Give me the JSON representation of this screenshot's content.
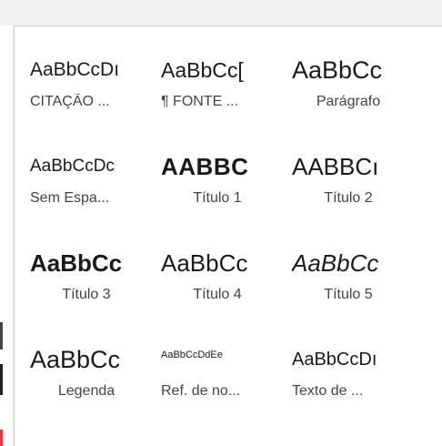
{
  "gallery": {
    "tiles": [
      {
        "preview": "AaBbCcDı",
        "label": "CITAÇÃO ..."
      },
      {
        "preview": "AaBbCc[",
        "label": "¶ FONTE ..."
      },
      {
        "preview": "AaBbCc",
        "label": "Parágrafo"
      },
      {
        "preview": "AaBbCcDc",
        "label": "Sem Espa..."
      },
      {
        "preview": "AABBC",
        "label": "Título 1"
      },
      {
        "preview": "AABBCı",
        "label": "Título 2"
      },
      {
        "preview": "AaBbCc",
        "label": "Título 3"
      },
      {
        "preview": "AaBbCc",
        "label": "Título 4"
      },
      {
        "preview": "AaBbCc",
        "label": "Título 5"
      },
      {
        "preview": "AaBbCc",
        "label": "Legenda"
      },
      {
        "preview": "AaBbCcDdEe",
        "label": "Ref. de no..."
      },
      {
        "preview": "AaBbCcDı",
        "label": "Texto de ..."
      }
    ]
  }
}
